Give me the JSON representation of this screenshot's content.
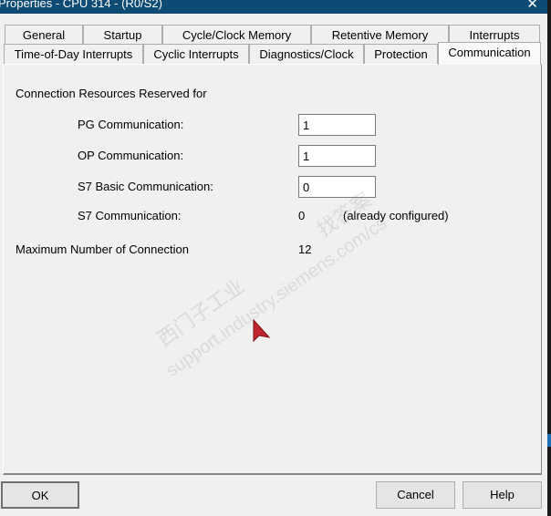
{
  "window": {
    "title": "Properties - CPU 314 - (R0/S2)",
    "close_icon": "close-icon"
  },
  "tabs_row1": [
    "General",
    "Startup",
    "Cycle/Clock Memory",
    "Retentive Memory",
    "Interrupts"
  ],
  "tabs_row2": [
    "Time-of-Day Interrupts",
    "Cyclic Interrupts",
    "Diagnostics/Clock",
    "Protection",
    "Communication"
  ],
  "active_tab": "Communication",
  "communication": {
    "section_label": "Connection Resources Reserved for",
    "pg_label": "PG Communication:",
    "pg_value": "1",
    "op_label": "OP Communication:",
    "op_value": "1",
    "s7basic_label": "S7 Basic Communication:",
    "s7basic_value": "0",
    "s7_label": "S7 Communication:",
    "s7_value": "0",
    "s7_note": "(already configured)",
    "max_label": "Maximum Number of Connection",
    "max_value": "12"
  },
  "watermark": {
    "line1": "西门子工业",
    "line2": "support.industry.siemens.com/cs",
    "line3": "找答案"
  },
  "buttons": {
    "ok": "OK",
    "cancel": "Cancel",
    "help": "Help"
  },
  "colors": {
    "titlebar": "#0d4a74",
    "cursor": "#c0272d"
  }
}
